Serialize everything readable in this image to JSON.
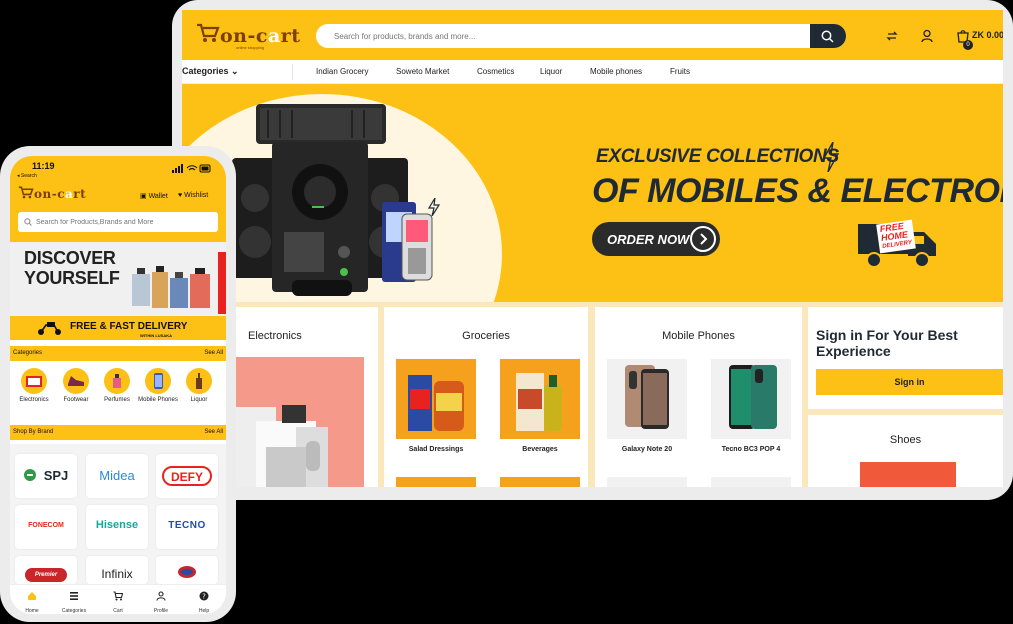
{
  "desktop": {
    "logo": {
      "text_a": "on-c",
      "text_b": "rt",
      "tagline": "online shopping"
    },
    "search": {
      "placeholder": "Search for products, brands and more..."
    },
    "cart_badge": "0",
    "cart_total": "ZK 0.00",
    "nav": {
      "categories": "Categories",
      "items": [
        "Indian Grocery",
        "Soweto Market",
        "Cosmetics",
        "Liquor",
        "Mobile phones",
        "Fruits"
      ]
    },
    "banner": {
      "line1": "EXCLUSIVE COLLECTIONS",
      "line2": "OF MOBILES & ELECTRONICS",
      "cta": "ORDER NOW",
      "badge_line1": "FREE",
      "badge_line2": "HOME",
      "badge_line3": "DELIVERY"
    },
    "cards": [
      {
        "title": "Electronics"
      },
      {
        "title": "Groceries",
        "items": [
          "Salad Dressings",
          "Beverages"
        ]
      },
      {
        "title": "Mobile Phones",
        "items": [
          "Galaxy Note 20",
          "Tecno BC3 POP 4"
        ]
      }
    ],
    "signin": {
      "title": "Sign in For Your Best Experience",
      "button": "Sign in"
    },
    "shoes": {
      "title": "Shoes"
    }
  },
  "phone": {
    "time": "11:19",
    "back": "◂ Search",
    "logo": {
      "text_a": "on-c",
      "text_b": "rt"
    },
    "wallet": "Wallet",
    "wishlist": "Wishlist",
    "search": {
      "placeholder": "Search for Products,Brands and More"
    },
    "banner": {
      "line1": "DISCOVER",
      "line2": "YOURSELF"
    },
    "promo": {
      "text": "FREE & FAST DELIVERY",
      "sub": "WITHIN LUSAKA"
    },
    "categories_section": {
      "label": "Categories",
      "see_all": "See All"
    },
    "categories": [
      "Electronics",
      "Footwear",
      "Perfumes",
      "Mobile Phones",
      "Liquor"
    ],
    "brands_section": {
      "label": "Shop By Brand",
      "see_all": "See All"
    },
    "brands": [
      "SPJ",
      "Midea",
      "DEFY",
      "FONECOM",
      "Hisense",
      "TECNO",
      "Premier",
      "Infinix",
      ""
    ],
    "tabs": [
      "Home",
      "Categories",
      "Cart",
      "Profile",
      "Help"
    ],
    "colors": {
      "accent": "#fdc014",
      "dark": "#1f2a35"
    }
  }
}
